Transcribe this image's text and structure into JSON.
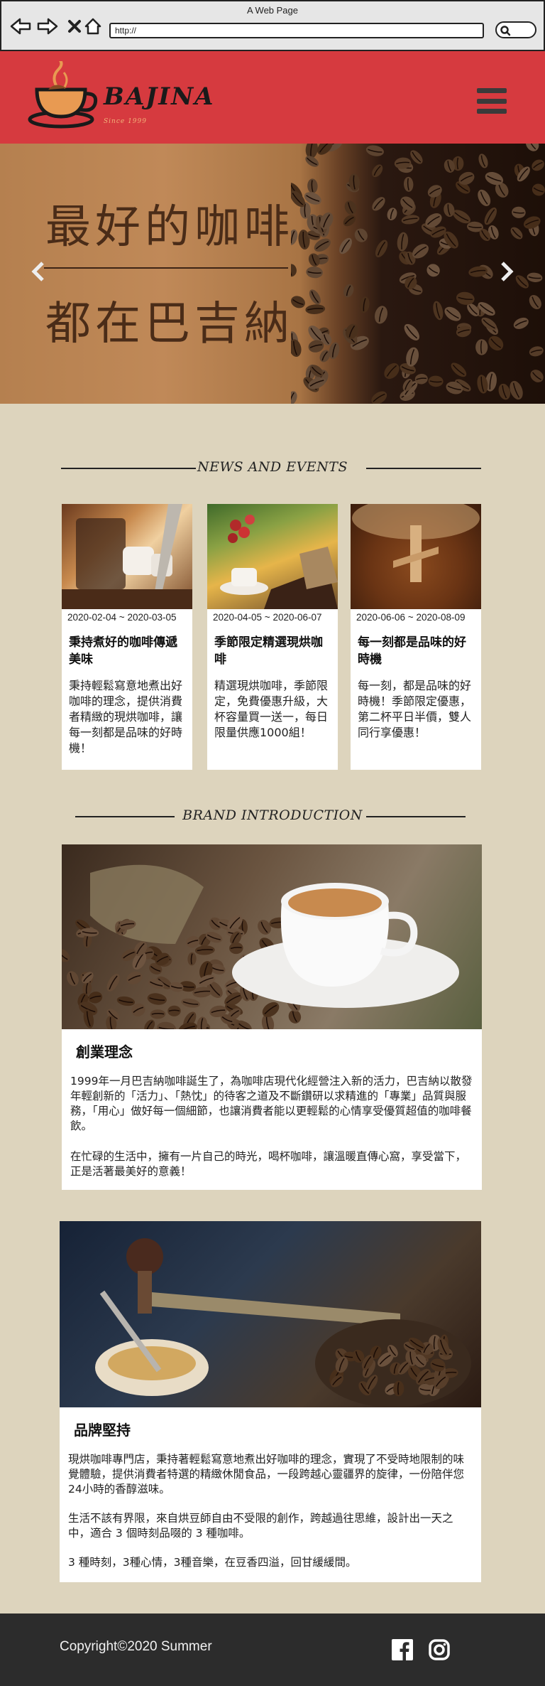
{
  "browser": {
    "title": "A Web Page",
    "url": "http://"
  },
  "brand": {
    "logo_text": "BAJINA",
    "logo_since": "Since 1999"
  },
  "hero": {
    "line1": "最好的咖啡",
    "line2": "都在巴吉納"
  },
  "news": {
    "section_title": "NEWS AND EVENTS",
    "cards": [
      {
        "date": "2020-02-04 ~ 2020-03-05",
        "title": "秉持煮好的咖啡傳遞美味",
        "body": "秉持輕鬆寫意地煮出好咖啡的理念，提供消費者精緻的現烘咖啡，讓每一刻都是品味的好時機！"
      },
      {
        "date": "2020-04-05 ~ 2020-06-07",
        "title": "季節限定精選現烘咖啡",
        "body": "精選現烘咖啡，季節限定，免費優惠升級，大杯容量買一送一，每日限量供應1000組！"
      },
      {
        "date": "2020-06-06 ~ 2020-08-09",
        "title": "每一刻都是品味的好時機",
        "body": "每一刻，都是品味的好時機！季節限定優惠，第二杯平日半價，雙人同行享優惠！"
      }
    ]
  },
  "brand_intro": {
    "section_title": "BRAND INTRODUCTION",
    "blocks": [
      {
        "title": "創業理念",
        "paragraphs": [
          "1999年一月巴吉納咖啡誕生了，為咖啡店現代化經營注入新的活力，巴吉納以散發年輕創新的「活力」、「熱忱」的待客之道及不斷鑽研以求精進的「專業」品質與服務，「用心」做好每一個細節，也讓消費者能以更輕鬆的心情享受優質超值的咖啡餐飲。",
          "在忙碌的生活中，擁有一片自己的時光，喝杯咖啡，讓溫暖直傳心窩，享受當下，正是活著最美好的意義！"
        ]
      },
      {
        "title": "品牌堅持",
        "paragraphs": [
          "現烘咖啡專門店，秉持著輕鬆寫意地煮出好咖啡的理念，實現了不受時地限制的味覺體驗，提供消費者特選的精緻休閒食品，一段跨越心靈疆界的旋律，一份陪伴您24小時的香醇滋味。",
          "生活不該有界限，來自烘豆師自由不受限的創作，跨越過往思維，設計出一天之中，適合 3 個時刻品啜的 3 種咖啡。",
          "3 種時刻，3種心情，3種音樂，在豆香四溢，回甘緩緩間。"
        ]
      }
    ]
  },
  "footer": {
    "copyright": "Copyright©2020 Summer"
  },
  "icons": [
    "back-icon",
    "forward-icon",
    "close-icon",
    "home-icon",
    "search-icon",
    "menu-icon",
    "chevron-left-icon",
    "chevron-right-icon",
    "facebook-icon",
    "instagram-icon"
  ],
  "colors": {
    "header": "#d63a3f",
    "page_bg": "#ddd4bd",
    "footer": "#2c2c2c"
  }
}
